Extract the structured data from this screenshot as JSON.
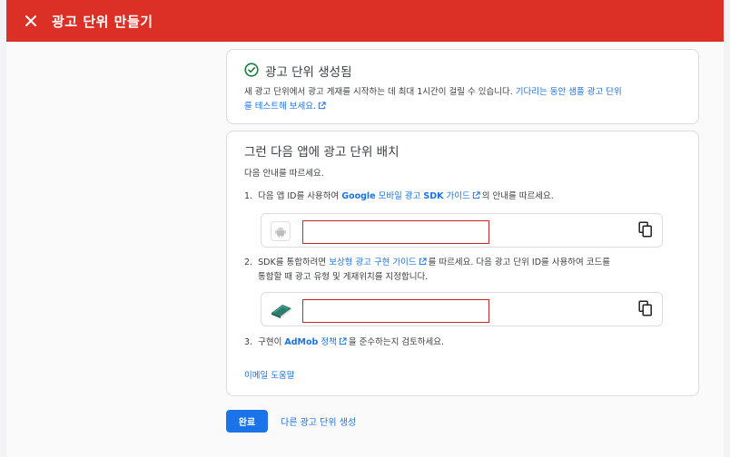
{
  "header": {
    "title": "광고 단위 만들기",
    "close_icon": "close-icon"
  },
  "success_card": {
    "title": "광고 단위 생성됨",
    "body_text": "새 광고 단위에서 광고 게재를 시작하는 데 최대 1시간이 걸릴 수 있습니다.",
    "link_part1": "기다리는 동안 샘플 광고 단위",
    "link_part2": "를 테스트해 보세요."
  },
  "placement_card": {
    "title": "그런 다음 앱에 광고 단위 배치",
    "intro": "다음 안내를 따르세요.",
    "step1": {
      "number": "1.",
      "prefix": "다음 앱 ID를 사용하여",
      "link_bold": "Google",
      "link_mid": "모바일 광고",
      "link_bold2": "SDK",
      "link_end": "가이드",
      "suffix": "의 안내를 따르세요."
    },
    "step2": {
      "number": "2.",
      "prefix": "SDK를 통합하려면",
      "link": "보상형 광고 구현 가이드",
      "suffix": "를 따르세요. 다음 광고 단위 ID를 사용하여 코드를",
      "line2": "통합할 때 광고 유형 및 게재위치를 지정합니다."
    },
    "step3": {
      "number": "3.",
      "prefix": "구현이",
      "link_bold": "AdMob",
      "link_rest": "정책",
      "suffix": "을 준수하는지 검토하세요."
    },
    "email_help": "이메일 도움말"
  },
  "footer": {
    "done_label": "완료",
    "create_another_label": "다른 광고 단위 생성"
  },
  "colors": {
    "header": "#dc2f25",
    "accent": "#1a73e8",
    "success": "#188038",
    "redaction_border": "#c62828"
  }
}
